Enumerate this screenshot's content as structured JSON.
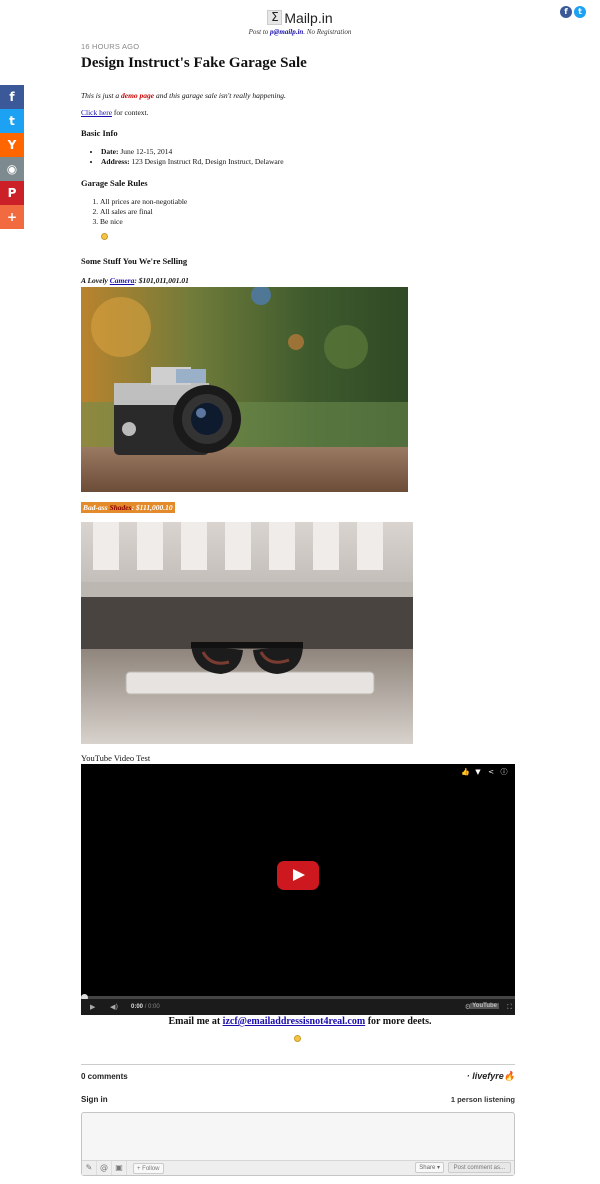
{
  "header": {
    "brand_symbol": "Σ",
    "brand_name": "Mailp.in",
    "tagline_prefix": "Post to",
    "tagline_handle": "p@mailp.in",
    "tagline_suffix": ". No Registration"
  },
  "top_social": [
    {
      "name": "facebook",
      "glyph": "f",
      "color": "#3b5998"
    },
    {
      "name": "twitter",
      "glyph": "t",
      "color": "#1da1f2"
    }
  ],
  "share_bar": [
    {
      "name": "facebook",
      "glyph": "f",
      "color": "#3b5998"
    },
    {
      "name": "twitter",
      "glyph": "t",
      "color": "#1da1f2"
    },
    {
      "name": "hacker-news",
      "glyph": "Y",
      "color": "#ff6600"
    },
    {
      "name": "reddit",
      "glyph": "◉",
      "color": "#7d8a8f"
    },
    {
      "name": "pinterest",
      "glyph": "P",
      "color": "#cb2027"
    },
    {
      "name": "more",
      "glyph": "+",
      "color": "#f26a3f"
    }
  ],
  "post": {
    "time_ago": "16 HOURS AGO",
    "title": "Design Instruct's Fake Garage Sale",
    "intro_pre": "This is just a",
    "intro_link": "demo page",
    "intro_post": "and this garage sale isn't really happening.",
    "context_link": "Click here",
    "context_text": "for context.",
    "basic_info_heading": "Basic Info",
    "date_label": "Date:",
    "date_value": "June 12-15, 2014",
    "address_label": "Address:",
    "address_value": "123 Design Instruct Rd, Design Instruct, Delaware",
    "rules_heading": "Garage Sale Rules",
    "rules": [
      "All prices are non-negotiable",
      "All sales are final",
      "Be nice"
    ],
    "selling_heading": "Some Stuff You We're Selling",
    "camera_label_pre": "A Lovely",
    "camera_link": "Camera",
    "camera_price": ": $101,011,001.01",
    "shades_pre": "Bad-ass",
    "shades_word": "Shades",
    "shades_price": ": $111,000.10",
    "video_label": "YouTube Video Test",
    "video_time_current": "0:00",
    "video_time_total": "/ 0:00",
    "yt_logo": "YouTube",
    "email_pre": "Email me at",
    "email_link": "izcf@emailaddressisnot4real.com",
    "email_post": "for more deets."
  },
  "comments": {
    "count": "0 comments",
    "brand": "· livefyre",
    "signin": "Sign in",
    "listening": "1 person listening",
    "follow": "+ Follow",
    "share": "Share ▾",
    "post_button": "Post comment as..."
  }
}
